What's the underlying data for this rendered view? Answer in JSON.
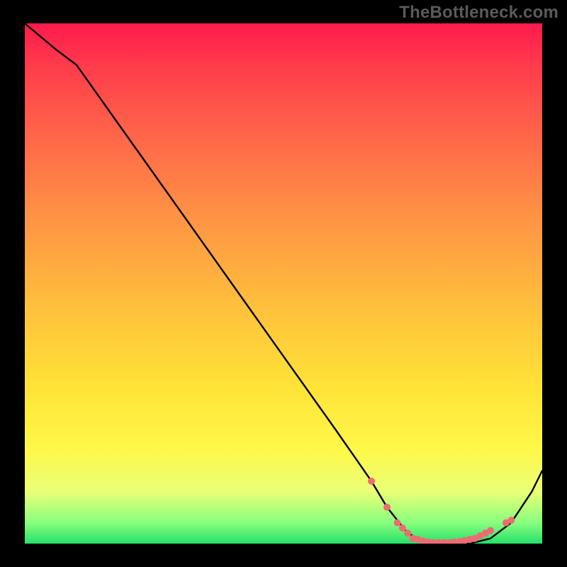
{
  "watermark": "TheBottleneck.com",
  "chart_data": {
    "type": "line",
    "title": "",
    "xlabel": "",
    "ylabel": "",
    "xlim": [
      0,
      100
    ],
    "ylim": [
      0,
      100
    ],
    "series": [
      {
        "name": "curve",
        "x": [
          0,
          6,
          10,
          20,
          30,
          40,
          50,
          60,
          67,
          70,
          74,
          78,
          82,
          86,
          90,
          94,
          98,
          100
        ],
        "y": [
          100,
          95,
          92,
          78,
          64,
          50,
          36,
          22,
          12,
          7,
          2,
          0,
          0,
          0,
          1,
          4,
          10,
          14
        ]
      }
    ],
    "markers": {
      "name": "highlight-dots",
      "color": "#ef6b73",
      "x": [
        67,
        70,
        72,
        73,
        74,
        75,
        76,
        77,
        78,
        79,
        80,
        81,
        82,
        83,
        84,
        85,
        86,
        87,
        88,
        89,
        90,
        93,
        94
      ],
      "y": [
        12,
        7,
        4,
        3,
        2,
        1,
        0.8,
        0.5,
        0.3,
        0.2,
        0.2,
        0.2,
        0.2,
        0.3,
        0.4,
        0.6,
        0.8,
        1,
        1.5,
        2,
        2.5,
        4,
        4.5
      ]
    }
  }
}
